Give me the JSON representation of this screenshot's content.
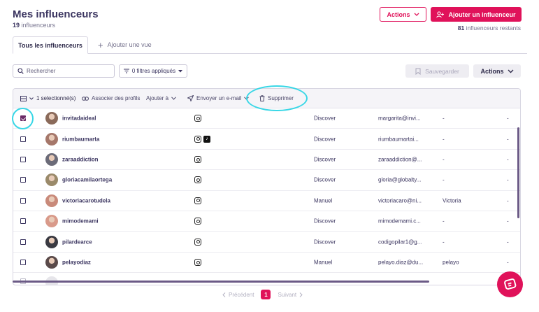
{
  "header": {
    "title": "Mes influenceurs",
    "count": "19",
    "count_label": "influenceurs",
    "actions_label": "Actions",
    "add_label": "Ajouter un influenceur",
    "remaining_count": "81",
    "remaining_label": "influenceurs restants"
  },
  "tabs": {
    "active": "Tous les influenceurs",
    "add_view": "Ajouter une vue"
  },
  "filters": {
    "search_placeholder": "Rechercher",
    "filters_label": "0 filtres appliqués",
    "save_label": "Sauvegarder",
    "actions_label": "Actions"
  },
  "bulk": {
    "selected": "1 selectionné(s)",
    "associate": "Associer des profils",
    "add_to": "Ajouter à",
    "send_email": "Envoyer un e-mail",
    "delete": "Supprimer"
  },
  "rows": [
    {
      "name": "invitadaideal",
      "networks": [
        "instagram"
      ],
      "source": "Discover",
      "email": "margarita@invi...",
      "c5": "-",
      "c6": "-",
      "checked": true,
      "avatar_color": "#8a6a5a"
    },
    {
      "name": "riumbaumarta",
      "networks": [
        "instagram",
        "tiktok"
      ],
      "source": "Discover",
      "email": "riumbaumartai...",
      "c5": "-",
      "c6": "-",
      "checked": false,
      "avatar_color": "#a5776a"
    },
    {
      "name": "zaraaddiction",
      "networks": [
        "instagram"
      ],
      "source": "Discover",
      "email": "zaraaddiction@...",
      "c5": "-",
      "c6": "-",
      "checked": false,
      "avatar_color": "#6b6b78"
    },
    {
      "name": "gloriacamilaortega",
      "networks": [
        "instagram"
      ],
      "source": "Discover",
      "email": "gloria@globalty...",
      "c5": "-",
      "c6": "-",
      "checked": false,
      "avatar_color": "#9a8a6a"
    },
    {
      "name": "victoriacarotudela",
      "networks": [
        "instagram"
      ],
      "source": "Manuel",
      "email": "victoriacaro@ni...",
      "c5": "Victoria",
      "c6": "-",
      "checked": false,
      "avatar_color": "#c98a7a"
    },
    {
      "name": "mimodemami",
      "networks": [
        "instagram"
      ],
      "source": "Discover",
      "email": "mimodemami.c...",
      "c5": "-",
      "c6": "-",
      "checked": false,
      "avatar_color": "#d99a8a"
    },
    {
      "name": "pilardearce",
      "networks": [
        "instagram"
      ],
      "source": "Discover",
      "email": "codigopilar1@g...",
      "c5": "-",
      "c6": "-",
      "checked": false,
      "avatar_color": "#3a3a42"
    },
    {
      "name": "pelayodiaz",
      "networks": [
        "instagram"
      ],
      "source": "Manuel",
      "email": "pelayo.diaz@du...",
      "c5": "pelayo",
      "c6": "-",
      "checked": false,
      "avatar_color": "#5a4a4a"
    }
  ],
  "pagination": {
    "prev": "Précédent",
    "page": "1",
    "next": "Suivant"
  },
  "colors": {
    "brand": "#e0125a",
    "checkbox_checked": "#6b2b66",
    "highlight": "#39d7e6"
  }
}
